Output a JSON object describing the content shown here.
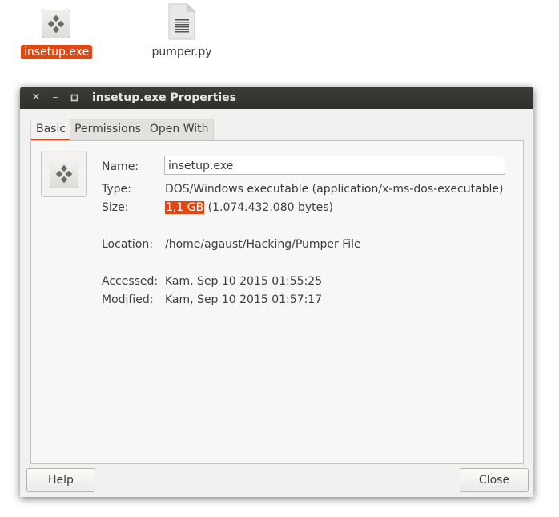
{
  "desktop": {
    "icons": [
      {
        "label": "insetup.exe",
        "icon": "executable-icon",
        "selected": true
      },
      {
        "label": "pumper.py",
        "icon": "text-file-icon",
        "selected": false
      }
    ]
  },
  "window": {
    "title": "insetup.exe Properties",
    "controls": {
      "close": "✕",
      "minimize": "–",
      "maximize": "▫"
    }
  },
  "tabs": [
    {
      "label": "Basic",
      "active": true
    },
    {
      "label": "Permissions",
      "active": false
    },
    {
      "label": "Open With",
      "active": false
    }
  ],
  "basic": {
    "icon": "executable-icon",
    "name_label": "Name:",
    "name_value": "insetup.exe",
    "type_label": "Type:",
    "type_value": "DOS/Windows executable (application/x-ms-dos-executable)",
    "size_label": "Size:",
    "size_short": "1,1 GB",
    "size_bytes": "(1.074.432.080 bytes)",
    "location_label": "Location:",
    "location_value": "/home/agaust/Hacking/Pumper File",
    "accessed_label": "Accessed:",
    "accessed_value": "Kam, Sep 10 2015 01:55:25",
    "modified_label": "Modified:",
    "modified_value": "Kam, Sep 10 2015 01:57:17"
  },
  "buttons": {
    "help": "Help",
    "close": "Close"
  },
  "colors": {
    "accent": "#dd4814",
    "titlebar": "#3d3c38"
  }
}
